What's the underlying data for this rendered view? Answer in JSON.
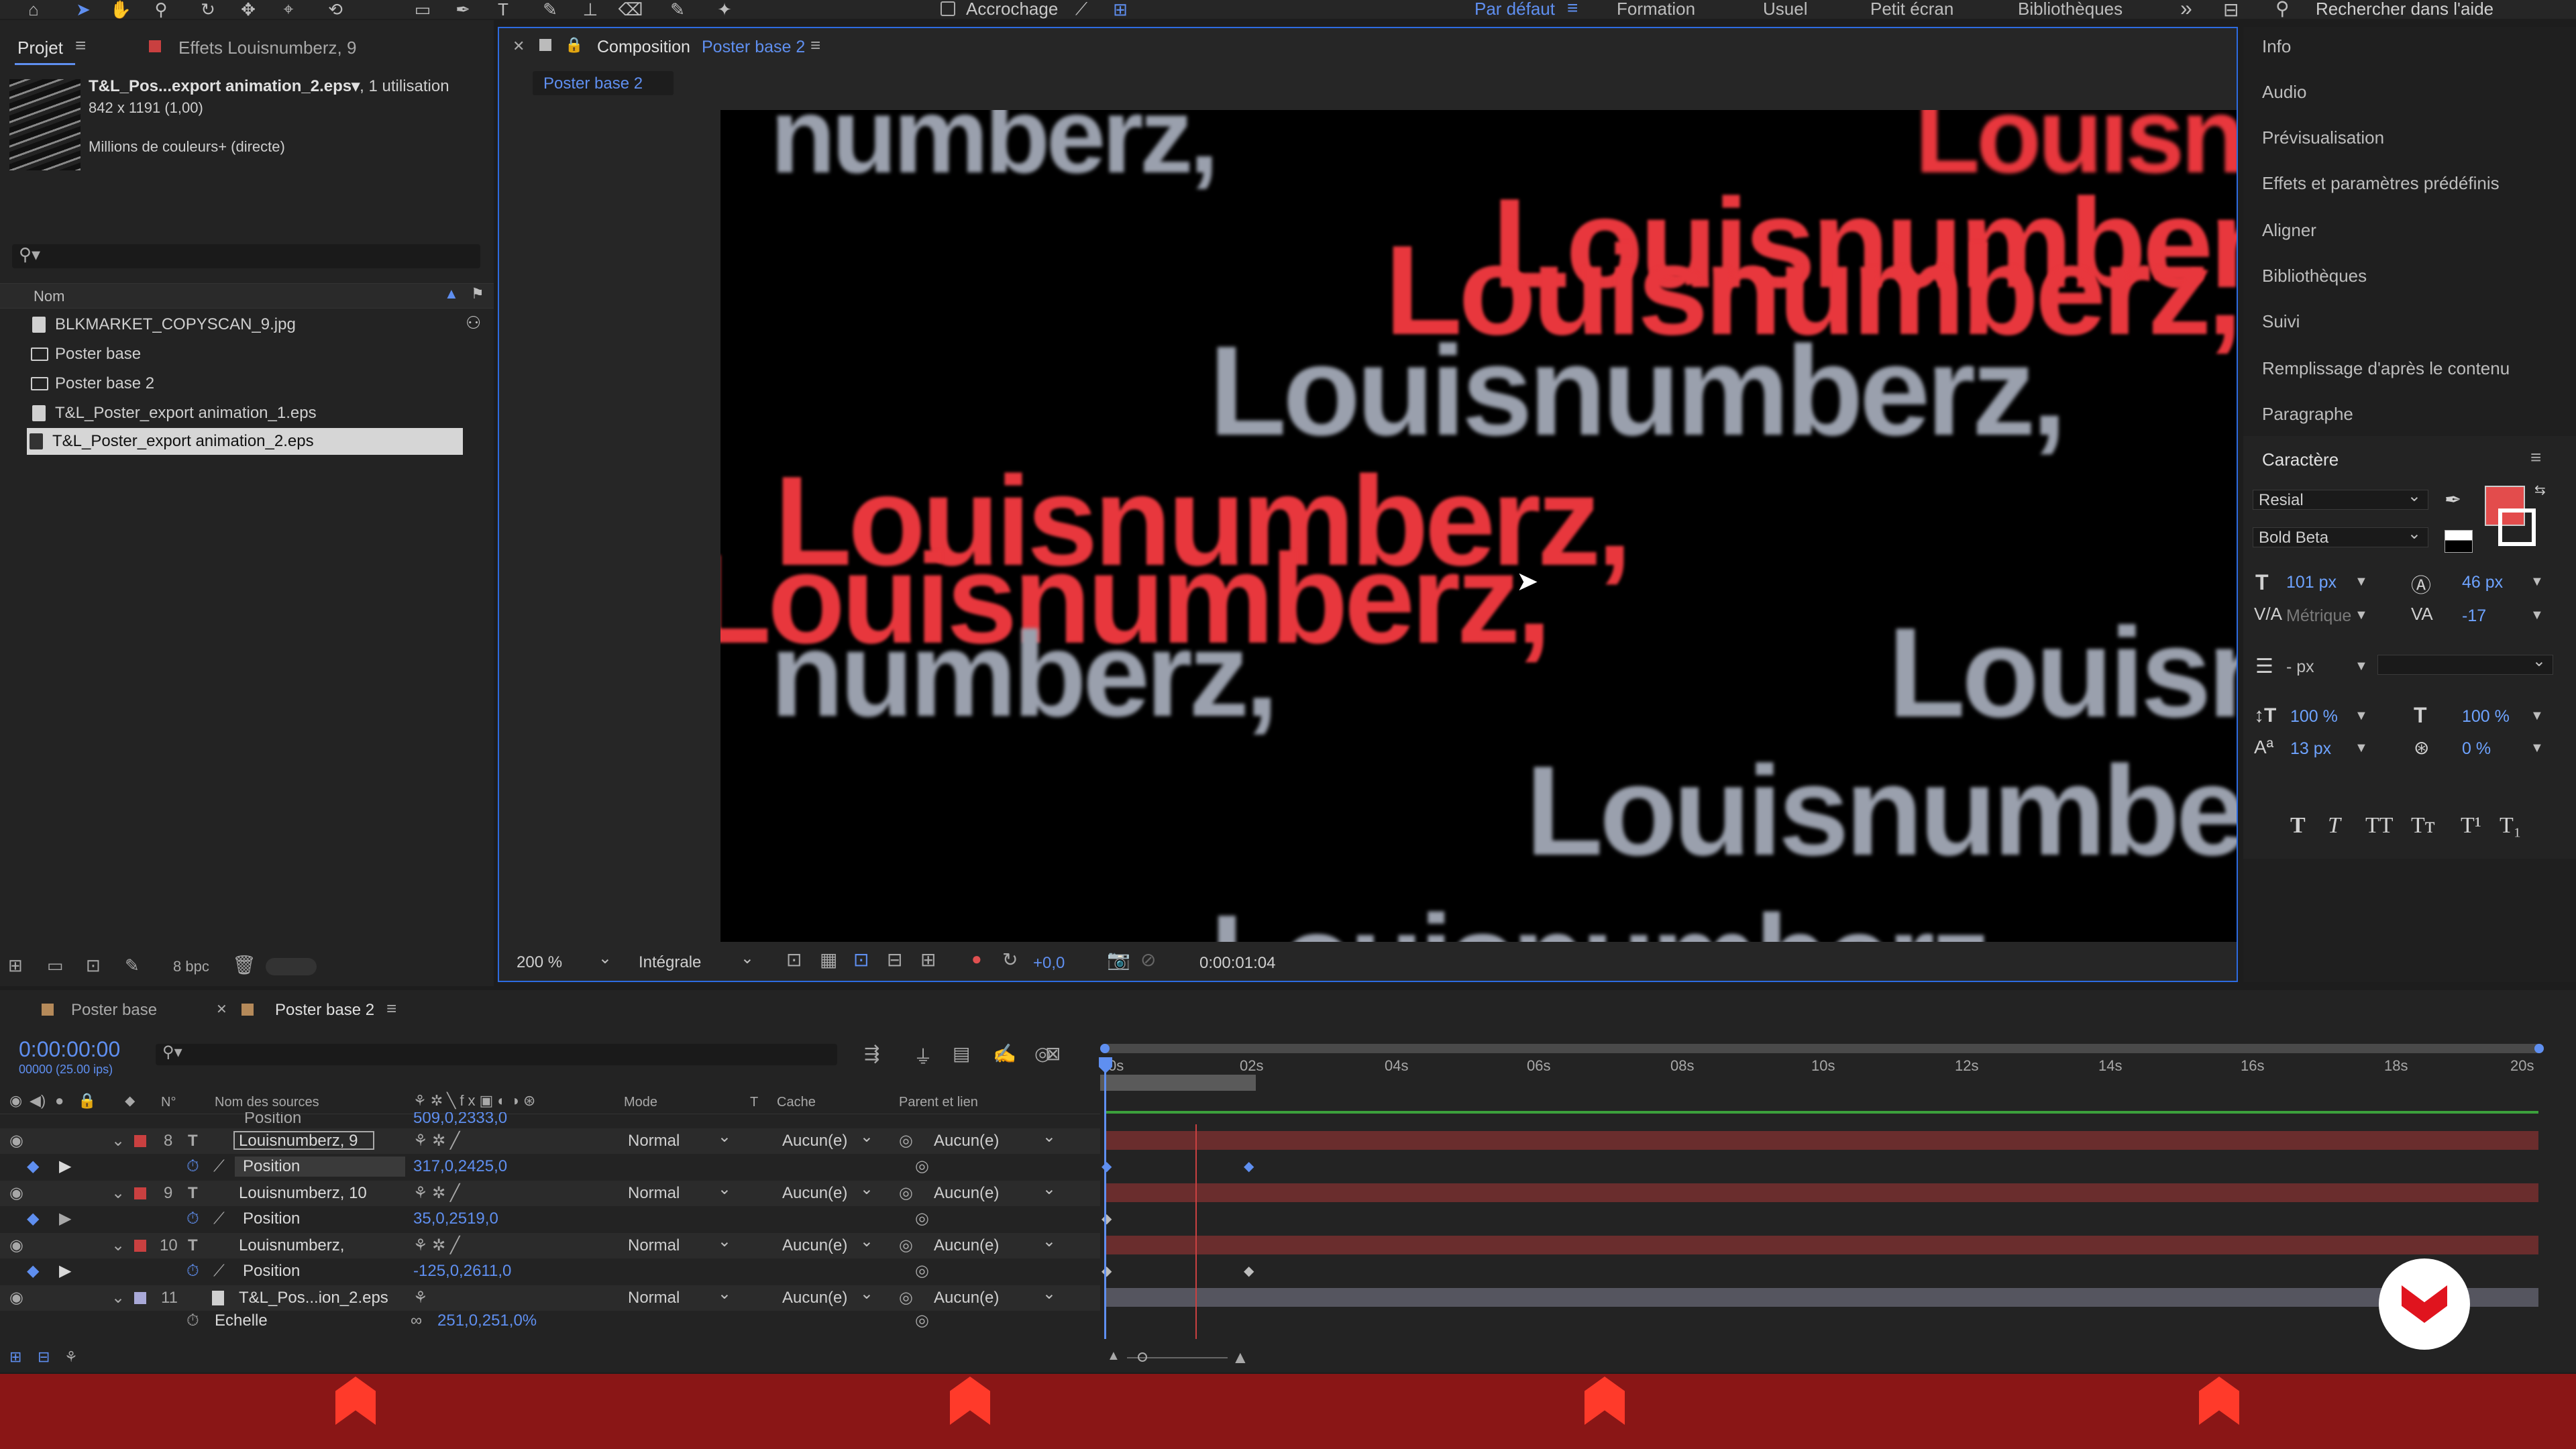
{
  "toolbar": {
    "snap_label": "Accrochage",
    "workspaces": [
      "Par défaut",
      "Formation",
      "Usuel",
      "Petit écran",
      "Bibliothèques"
    ],
    "active_workspace": "Par défaut",
    "search_help": "Rechercher dans l'aide"
  },
  "project": {
    "tab_label": "Projet",
    "effects_tab": "Effets  Louisnumberz, 9",
    "selected_name": "T&L_Pos...export animation_2.eps▾",
    "usage": ", 1 utilisation",
    "dims": "842 x 1191 (1,00)",
    "colors": "Millions de couleurs+ (directe)",
    "col_name": "Nom",
    "items": [
      {
        "name": "BLKMARKET_COPYSCAN_9.jpg",
        "type": "file"
      },
      {
        "name": "Poster base",
        "type": "comp"
      },
      {
        "name": "Poster base 2",
        "type": "comp"
      },
      {
        "name": "T&L_Poster_export animation_1.eps",
        "type": "file"
      },
      {
        "name": "T&L_Poster_export animation_2.eps",
        "type": "file"
      }
    ],
    "bpc": "8 bpc"
  },
  "composition": {
    "tab_prefix": "Composition",
    "tab_name": "Poster base 2",
    "subtab": "Poster base 2",
    "zoom": "200 %",
    "resolution": "Intégrale",
    "exposure": "+0,0",
    "timecode": "0:00:01:04",
    "words": [
      "numberz,",
      "Louisnu",
      "Louisnumberz,",
      "Louisnumberz,",
      "Louisnumberz,",
      "Louisnumberz,",
      "Louisnumberz,",
      "numberz,",
      "Louisnu",
      "Louisnumberz,",
      "Louisnumberz,"
    ]
  },
  "right_panel": {
    "items": [
      "Info",
      "Audio",
      "Prévisualisation",
      "Effets et paramètres prédéfinis",
      "Aligner",
      "Bibliothèques",
      "Suivi",
      "Remplissage d'après le contenu",
      "Paragraphe"
    ],
    "character": {
      "title": "Caractère",
      "font": "Resial",
      "style": "Bold Beta",
      "size": "101 px",
      "leading": "46 px",
      "kerning": "Métrique",
      "tracking": "-17",
      "line_spacing": "- px",
      "vscale": "100 %",
      "hscale": "100 %",
      "baseline": "13 px",
      "tsume": "0 %",
      "fill_color": "#e34c4c",
      "style_buttons": [
        "T",
        "T",
        "TT",
        "Tт",
        "T¹",
        "T₁"
      ]
    }
  },
  "timeline": {
    "tabs": [
      "Poster base",
      "Poster base 2"
    ],
    "active_tab": "Poster base 2",
    "current_time": "0:00:00:00",
    "fps": "00000 (25.00 ips)",
    "col_headers": {
      "num": "N°",
      "source": "Nom des sources",
      "mode": "Mode",
      "t": "T",
      "cache": "Cache",
      "parent": "Parent et lien"
    },
    "ruler": [
      "0s",
      "02s",
      "04s",
      "06s",
      "08s",
      "10s",
      "12s",
      "14s",
      "16s",
      "18s",
      "20s"
    ],
    "top_partial": {
      "label": "Position",
      "value": "509,0,2333,0"
    },
    "layers": [
      {
        "num": "8",
        "name": "Louisnumberz, 9",
        "mode": "Normal",
        "cache": "Aucun(e)",
        "parent": "Aucun(e)",
        "color": "#c94040",
        "prop": "Position",
        "prop_value": "317,0,2425,0"
      },
      {
        "num": "9",
        "name": "Louisnumberz, 10",
        "mode": "Normal",
        "cache": "Aucun(e)",
        "parent": "Aucun(e)",
        "color": "#c94040",
        "prop": "Position",
        "prop_value": "35,0,2519,0"
      },
      {
        "num": "10",
        "name": "Louisnumberz,",
        "mode": "Normal",
        "cache": "Aucun(e)",
        "parent": "Aucun(e)",
        "color": "#c94040",
        "prop": "Position",
        "prop_value": "-125,0,2611,0"
      },
      {
        "num": "11",
        "name": "T&L_Pos...ion_2.eps",
        "mode": "Normal",
        "cache": "Aucun(e)",
        "parent": "Aucun(e)",
        "color": "#a9a9d8",
        "prop": "Echelle",
        "prop_value": "251,0,251,0%"
      }
    ]
  }
}
